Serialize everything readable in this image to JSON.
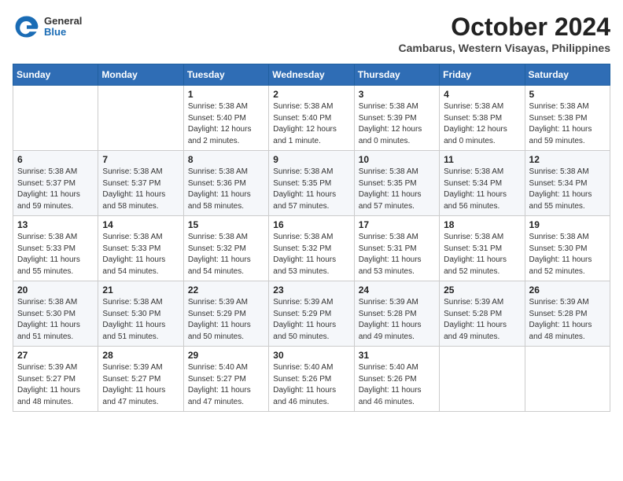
{
  "logo": {
    "general": "General",
    "blue": "Blue"
  },
  "header": {
    "month": "October 2024",
    "location": "Cambarus, Western Visayas, Philippines"
  },
  "weekdays": [
    "Sunday",
    "Monday",
    "Tuesday",
    "Wednesday",
    "Thursday",
    "Friday",
    "Saturday"
  ],
  "weeks": [
    [
      null,
      null,
      {
        "day": 1,
        "sunrise": "5:38 AM",
        "sunset": "5:40 PM",
        "daylight": "12 hours and 2 minutes."
      },
      {
        "day": 2,
        "sunrise": "5:38 AM",
        "sunset": "5:40 PM",
        "daylight": "12 hours and 1 minute."
      },
      {
        "day": 3,
        "sunrise": "5:38 AM",
        "sunset": "5:39 PM",
        "daylight": "12 hours and 0 minutes."
      },
      {
        "day": 4,
        "sunrise": "5:38 AM",
        "sunset": "5:38 PM",
        "daylight": "12 hours and 0 minutes."
      },
      {
        "day": 5,
        "sunrise": "5:38 AM",
        "sunset": "5:38 PM",
        "daylight": "11 hours and 59 minutes."
      }
    ],
    [
      {
        "day": 6,
        "sunrise": "5:38 AM",
        "sunset": "5:37 PM",
        "daylight": "11 hours and 59 minutes."
      },
      {
        "day": 7,
        "sunrise": "5:38 AM",
        "sunset": "5:37 PM",
        "daylight": "11 hours and 58 minutes."
      },
      {
        "day": 8,
        "sunrise": "5:38 AM",
        "sunset": "5:36 PM",
        "daylight": "11 hours and 58 minutes."
      },
      {
        "day": 9,
        "sunrise": "5:38 AM",
        "sunset": "5:35 PM",
        "daylight": "11 hours and 57 minutes."
      },
      {
        "day": 10,
        "sunrise": "5:38 AM",
        "sunset": "5:35 PM",
        "daylight": "11 hours and 57 minutes."
      },
      {
        "day": 11,
        "sunrise": "5:38 AM",
        "sunset": "5:34 PM",
        "daylight": "11 hours and 56 minutes."
      },
      {
        "day": 12,
        "sunrise": "5:38 AM",
        "sunset": "5:34 PM",
        "daylight": "11 hours and 55 minutes."
      }
    ],
    [
      {
        "day": 13,
        "sunrise": "5:38 AM",
        "sunset": "5:33 PM",
        "daylight": "11 hours and 55 minutes."
      },
      {
        "day": 14,
        "sunrise": "5:38 AM",
        "sunset": "5:33 PM",
        "daylight": "11 hours and 54 minutes."
      },
      {
        "day": 15,
        "sunrise": "5:38 AM",
        "sunset": "5:32 PM",
        "daylight": "11 hours and 54 minutes."
      },
      {
        "day": 16,
        "sunrise": "5:38 AM",
        "sunset": "5:32 PM",
        "daylight": "11 hours and 53 minutes."
      },
      {
        "day": 17,
        "sunrise": "5:38 AM",
        "sunset": "5:31 PM",
        "daylight": "11 hours and 53 minutes."
      },
      {
        "day": 18,
        "sunrise": "5:38 AM",
        "sunset": "5:31 PM",
        "daylight": "11 hours and 52 minutes."
      },
      {
        "day": 19,
        "sunrise": "5:38 AM",
        "sunset": "5:30 PM",
        "daylight": "11 hours and 52 minutes."
      }
    ],
    [
      {
        "day": 20,
        "sunrise": "5:38 AM",
        "sunset": "5:30 PM",
        "daylight": "11 hours and 51 minutes."
      },
      {
        "day": 21,
        "sunrise": "5:38 AM",
        "sunset": "5:30 PM",
        "daylight": "11 hours and 51 minutes."
      },
      {
        "day": 22,
        "sunrise": "5:39 AM",
        "sunset": "5:29 PM",
        "daylight": "11 hours and 50 minutes."
      },
      {
        "day": 23,
        "sunrise": "5:39 AM",
        "sunset": "5:29 PM",
        "daylight": "11 hours and 50 minutes."
      },
      {
        "day": 24,
        "sunrise": "5:39 AM",
        "sunset": "5:28 PM",
        "daylight": "11 hours and 49 minutes."
      },
      {
        "day": 25,
        "sunrise": "5:39 AM",
        "sunset": "5:28 PM",
        "daylight": "11 hours and 49 minutes."
      },
      {
        "day": 26,
        "sunrise": "5:39 AM",
        "sunset": "5:28 PM",
        "daylight": "11 hours and 48 minutes."
      }
    ],
    [
      {
        "day": 27,
        "sunrise": "5:39 AM",
        "sunset": "5:27 PM",
        "daylight": "11 hours and 48 minutes."
      },
      {
        "day": 28,
        "sunrise": "5:39 AM",
        "sunset": "5:27 PM",
        "daylight": "11 hours and 47 minutes."
      },
      {
        "day": 29,
        "sunrise": "5:40 AM",
        "sunset": "5:27 PM",
        "daylight": "11 hours and 47 minutes."
      },
      {
        "day": 30,
        "sunrise": "5:40 AM",
        "sunset": "5:26 PM",
        "daylight": "11 hours and 46 minutes."
      },
      {
        "day": 31,
        "sunrise": "5:40 AM",
        "sunset": "5:26 PM",
        "daylight": "11 hours and 46 minutes."
      },
      null,
      null
    ]
  ]
}
